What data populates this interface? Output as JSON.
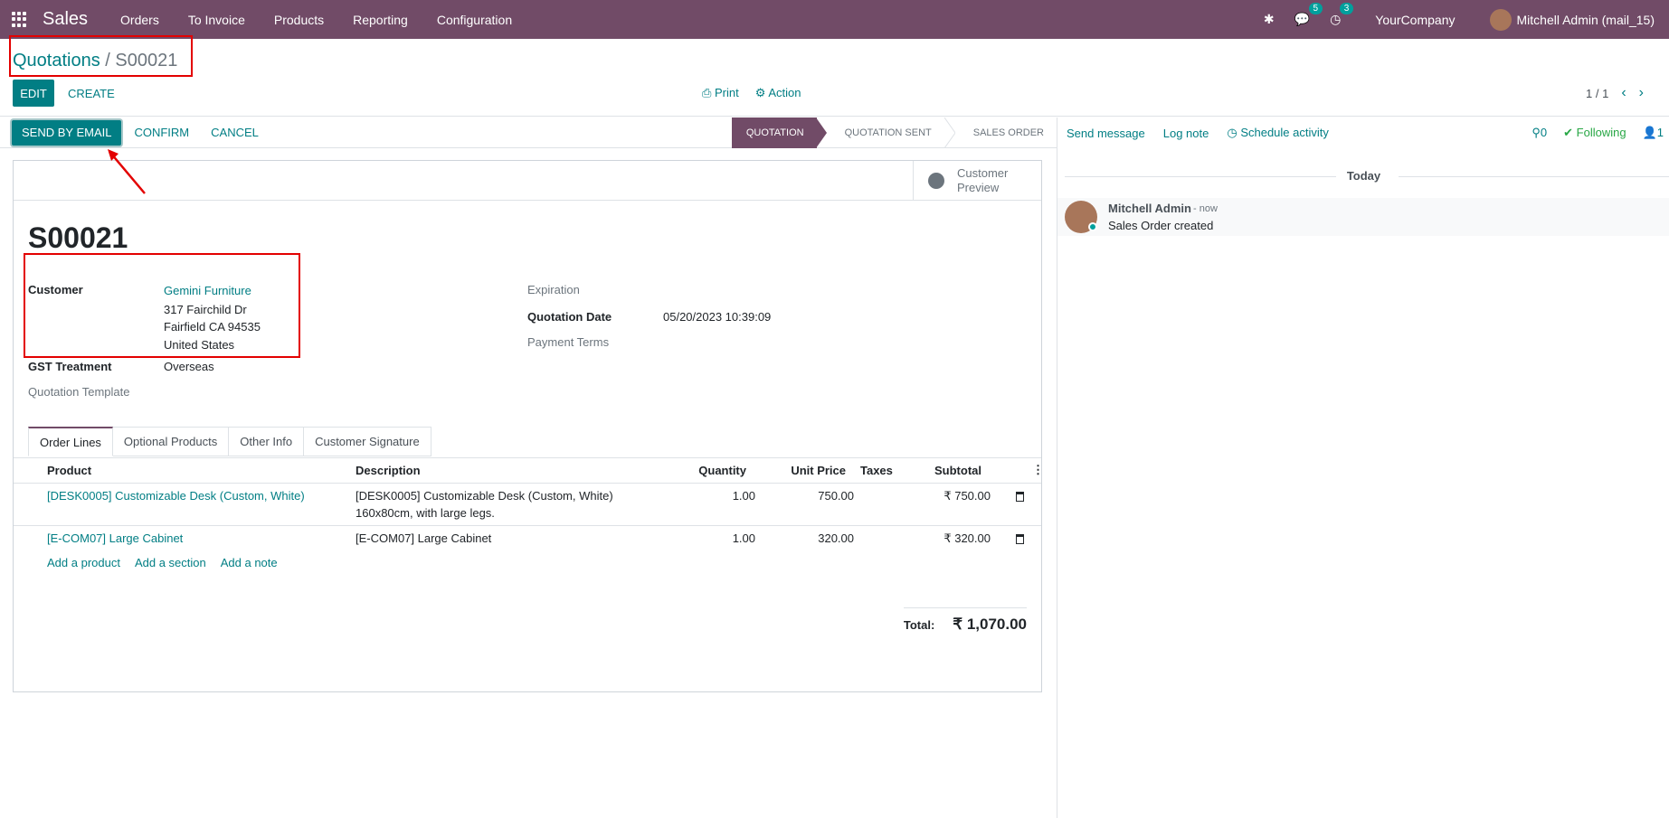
{
  "navbar": {
    "brand": "Sales",
    "menu": [
      "Orders",
      "To Invoice",
      "Products",
      "Reporting",
      "Configuration"
    ],
    "messages_count": "5",
    "activities_count": "3",
    "company": "YourCompany",
    "user": "Mitchell Admin (mail_15)"
  },
  "breadcrumb": {
    "parent": "Quotations",
    "separator": " / ",
    "current": "S00021"
  },
  "control": {
    "edit": "EDIT",
    "create": "CREATE",
    "print": "Print",
    "action": "Action",
    "pager": "1 / 1"
  },
  "statusbar": {
    "send_email": "SEND BY EMAIL",
    "confirm": "CONFIRM",
    "cancel": "CANCEL",
    "stages": [
      "QUOTATION",
      "QUOTATION SENT",
      "SALES ORDER"
    ],
    "active_stage": "QUOTATION"
  },
  "sheet": {
    "preview_label": "Customer Preview",
    "title": "S00021",
    "customer_label": "Customer",
    "customer_name": "Gemini Furniture",
    "address_line1": "317 Fairchild Dr",
    "address_line2": "Fairfield CA 94535",
    "address_line3": "United States",
    "gst_label": "GST Treatment",
    "gst_value": "Overseas",
    "template_label": "Quotation Template",
    "expiration_label": "Expiration",
    "quotation_date_label": "Quotation Date",
    "quotation_date": "05/20/2023 10:39:09",
    "payment_terms_label": "Payment Terms"
  },
  "tabs": [
    "Order Lines",
    "Optional Products",
    "Other Info",
    "Customer Signature"
  ],
  "table": {
    "headers": {
      "product": "Product",
      "description": "Description",
      "quantity": "Quantity",
      "unit_price": "Unit Price",
      "taxes": "Taxes",
      "subtotal": "Subtotal"
    },
    "rows": [
      {
        "product": "[DESK0005] Customizable Desk (Custom, White)",
        "description": "[DESK0005] Customizable Desk (Custom, White)",
        "description2": "160x80cm, with large legs.",
        "quantity": "1.00",
        "unit_price": "750.00",
        "taxes": "",
        "subtotal": "₹ 750.00"
      },
      {
        "product": "[E-COM07] Large Cabinet",
        "description": "[E-COM07] Large Cabinet",
        "description2": "",
        "quantity": "1.00",
        "unit_price": "320.00",
        "taxes": "",
        "subtotal": "₹ 320.00"
      }
    ],
    "add_product": "Add a product",
    "add_section": "Add a section",
    "add_note": "Add a note",
    "total_label": "Total:",
    "total_value": "₹ 1,070.00"
  },
  "chatter": {
    "send_message": "Send message",
    "log_note": "Log note",
    "schedule_activity": "Schedule activity",
    "attachments": "0",
    "following": "Following",
    "followers": "1",
    "today": "Today",
    "author": "Mitchell Admin",
    "time": "- now",
    "body": "Sales Order created"
  },
  "colors": {
    "brand": "#714b67",
    "accent": "#017e84",
    "annotation": "#e30000"
  }
}
